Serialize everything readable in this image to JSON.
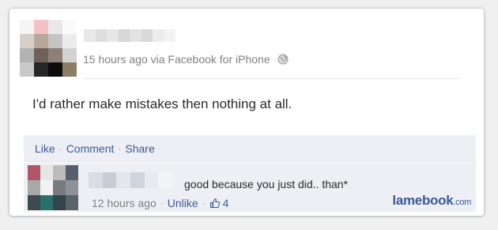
{
  "post": {
    "meta_text": "15 hours ago via Facebook for iPhone",
    "privacy_icon": "globe-icon",
    "status_text": "I'd rather make mistakes then nothing at all."
  },
  "actions": {
    "like": "Like",
    "comment": "Comment",
    "share": "Share",
    "separator": "·"
  },
  "comment": {
    "text": "good because you just did.. than*",
    "time": "12 hours ago",
    "unlike": "Unlike",
    "like_icon": "thumbs-up-icon",
    "like_count": "4"
  },
  "watermark": {
    "main": "lamebook",
    "suffix": ".com"
  },
  "colors": {
    "link": "#3b5998",
    "action_bar_bg": "#edeff4",
    "meta_text": "#808080",
    "card_bg": "#ffffff"
  }
}
